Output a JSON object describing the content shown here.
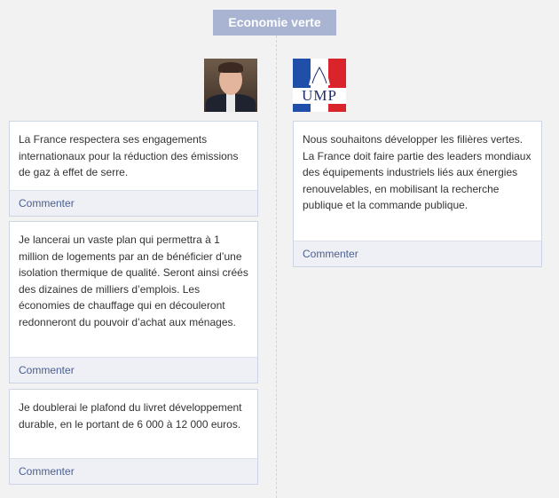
{
  "section_title": "Economie verte",
  "left": {
    "avatar_icon": "person-portrait",
    "posts": [
      {
        "text": "La France respectera ses engagements internationaux pour la réduction des émissions de gaz à effet de serre.",
        "comment_label": "Commenter"
      },
      {
        "text": "Je lancerai un vaste plan qui permettra à 1 million de logements par an de bénéficier d’une isolation thermique de qualité. Seront ainsi créés des dizaines de milliers d’emplois. Les économies de chauffage qui en découleront redonneront du pouvoir d’achat aux ménages.",
        "comment_label": "Commenter"
      },
      {
        "text": "Je doublerai le plafond du livret développement durable, en le portant de 6 000 à 12 000 euros.",
        "comment_label": "Commenter"
      }
    ]
  },
  "right": {
    "logo_text": "UMP",
    "posts": [
      {
        "text": "Nous souhaitons développer les filières vertes. La France doit faire partie des leaders mondiaux des équipements industriels liés aux énergies renouvelables, en mobilisant la recherche publique et la commande publique.",
        "comment_label": "Commenter"
      }
    ]
  },
  "colors": {
    "title_bg": "#a9b4d2",
    "link": "#4b5f91",
    "card_border": "#cdd4e4",
    "footer_bg": "#eef0f5"
  }
}
